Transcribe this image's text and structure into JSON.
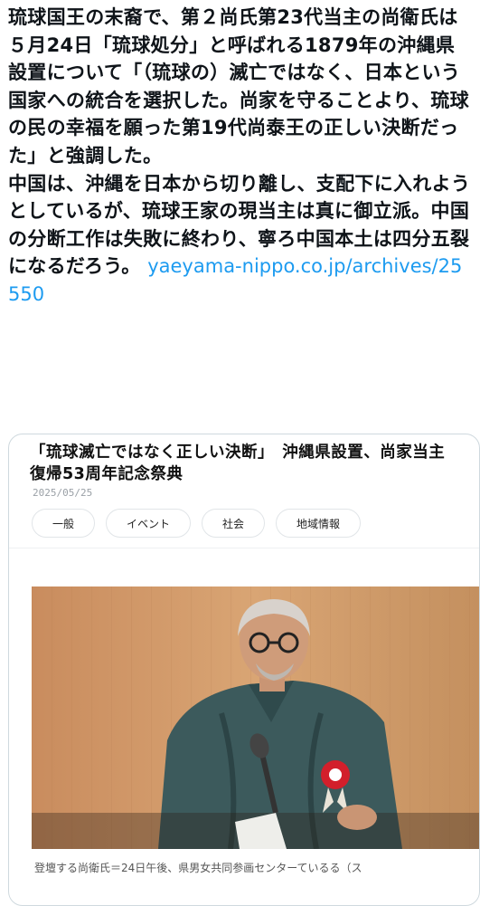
{
  "post": {
    "paragraph1": "琉球国王の末裔で、第２尚氏第23代当主の尚衛氏は５月24日「琉球処分」と呼ばれる1879年の沖縄県設置について「（琉球の）滅亡ではなく、日本という国家への統合を選択した。尚家を守ることより、琉球の民の幸福を願った第19代尚泰王の正しい決断だった」と強調した。",
    "paragraph2": "中国は、沖縄を日本から切り離し、支配下に入れようとしているが、琉球王家の現当主は真に御立派。中国の分断工作は失敗に終わり、寧ろ中国本土は四分五裂になるだろう。",
    "link": "yaeyama-nippo.co.jp/archives/25550"
  },
  "card": {
    "title": "「琉球滅亡ではなく正しい決断」　沖縄県設置、尚家当主　復帰53周年記念祭典",
    "date": "2025/05/25",
    "tags": [
      "一般",
      "イベント",
      "社会",
      "地域情報"
    ],
    "caption": "登壇する尚衛氏＝24日午後、県男女共同参画センターているる（ス"
  },
  "colors": {
    "link": "#1d9bf0",
    "text": "#0f1419",
    "border": "#cfd9de"
  }
}
